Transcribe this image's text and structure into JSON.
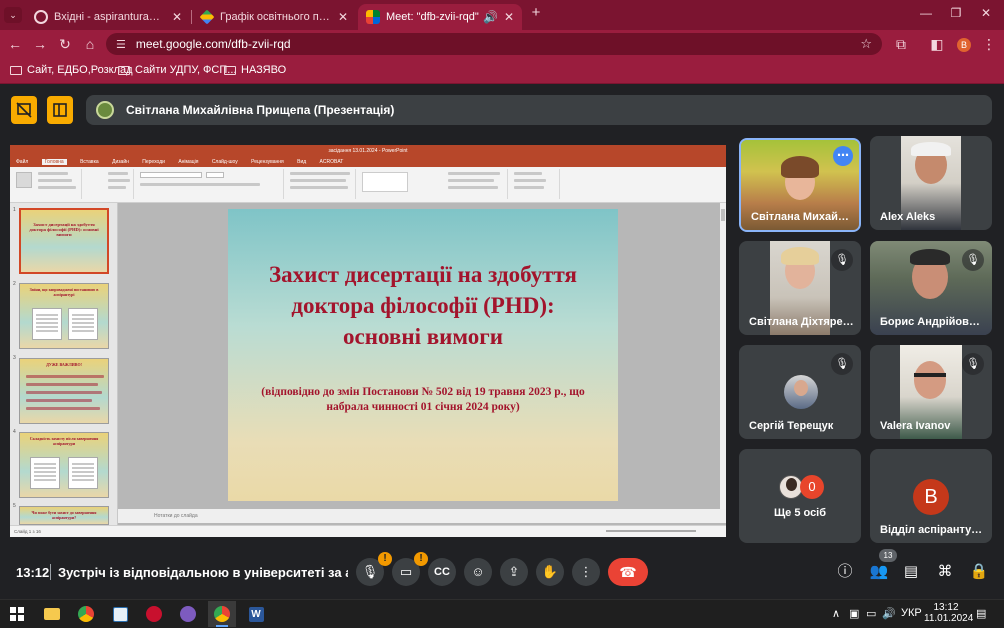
{
  "browser": {
    "tabs": [
      {
        "label": "Вхідні - aspirantura@udpu.edu.",
        "active": false
      },
      {
        "label": "Графік освітнього процесу для",
        "active": false
      },
      {
        "label": "Meet: \"dfb-zvii-rqd\"",
        "active": true
      }
    ],
    "new_tab": "+",
    "url": "meet.google.com/dfb-zvii-rqd",
    "profile_initial": "В",
    "bookmarks": [
      "Сайт, ЕДБО,Розклад",
      "Сайти УДПУ, ФСП...",
      "НАЗЯВО"
    ]
  },
  "meet": {
    "presenter_label": "Світлана Михайлівна Прищепа (Презентація)",
    "clock": "13:12",
    "meeting_name": "Зустріч із відповідальною в університеті за атестацію",
    "participant_count": "13",
    "tiles": [
      {
        "name": "Світлана Михайлів...",
        "muted": false
      },
      {
        "name": "Alex Aleks",
        "muted": false
      },
      {
        "name": "Світлана Діхтяренко",
        "muted": true
      },
      {
        "name": "Борис Андрійович ...",
        "muted": true
      },
      {
        "name": "Сергій Терещук",
        "muted": true
      },
      {
        "name": "Valera Ivanov",
        "muted": true
      },
      {
        "name": "Ще 5 осіб",
        "badge": "0"
      },
      {
        "name": "Відділ аспірантури...",
        "avatar_letter": "В"
      }
    ],
    "colors": {
      "accent": "#f9ab00",
      "end_call": "#ea4335",
      "tile_bg": "#3c4043",
      "speaking_border": "#8ab4f8"
    }
  },
  "presentation": {
    "window_title": "засідання 13.01.2024 - PowerPoint",
    "ribbon_tabs": [
      "Файл",
      "Головна",
      "Вставка",
      "Дизайн",
      "Переходи",
      "Анімація",
      "Слайд-шоу",
      "Рецензування",
      "Вид",
      "ACROBAT"
    ],
    "slide_title": "Захист дисертації на здобуття доктора філософії (PHD): основні вимоги",
    "slide_subtitle": "(відповідно до змін Постанови № 502 від 19 травня 2023 р., що набрала чинності 01 січня 2024 року)",
    "thumbnails": [
      {
        "num": "1",
        "text": "Захист дисертації на здобуття доктора філософії (PHD): основні вимоги"
      },
      {
        "num": "2",
        "text": "Зміни, що запроваджені постановою в аспірантурі"
      },
      {
        "num": "3",
        "text": "ДУЖЕ ВАЖЛИВО!"
      },
      {
        "num": "4",
        "text": "Складність захисту після завершення аспірантури"
      },
      {
        "num": "5",
        "text": "Чи може бути захист до завершення аспірантури?"
      }
    ],
    "notes_placeholder": "Нотатки до слайда",
    "status": "Слайд 1 з 16"
  },
  "taskbar": {
    "lang": "УКР",
    "time": "13:12",
    "date": "11.01.2024"
  }
}
